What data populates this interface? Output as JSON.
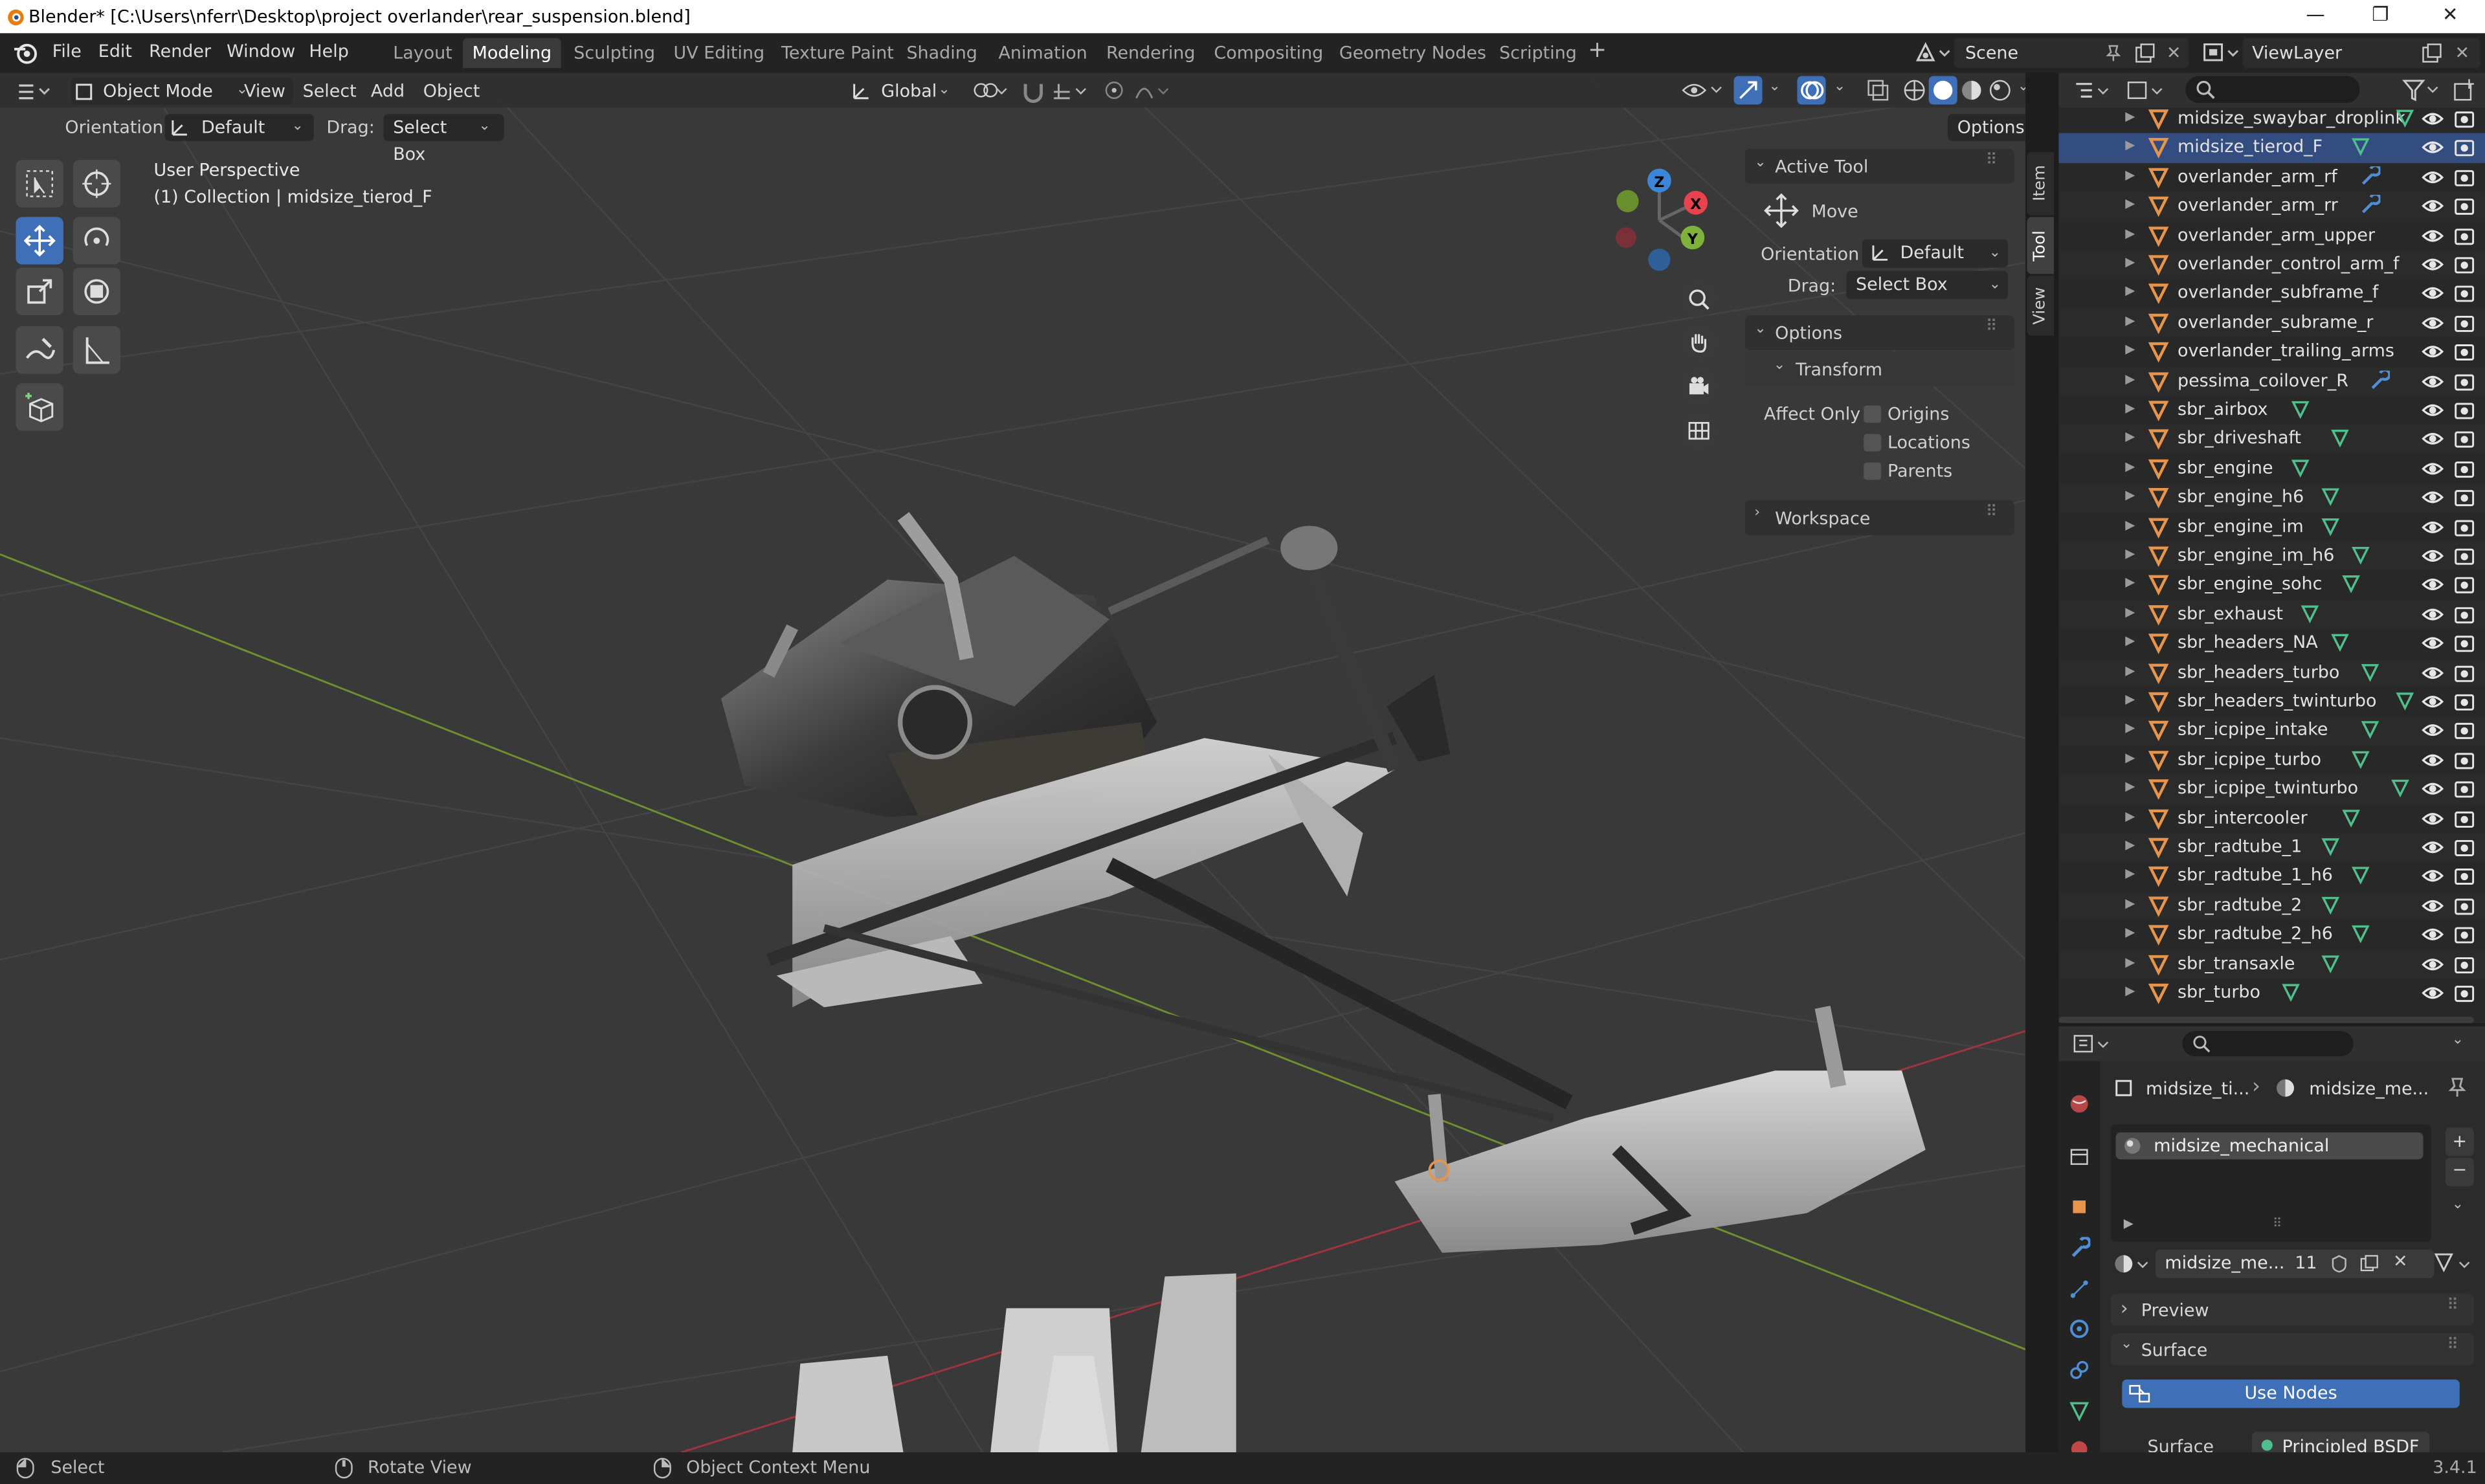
{
  "window": {
    "title": "Blender* [C:\\Users\\nferr\\Desktop\\project overlander\\rear_suspension.blend]",
    "minimize": "—",
    "maximize": "❐",
    "close": "✕"
  },
  "menu": [
    "File",
    "Edit",
    "Render",
    "Window",
    "Help"
  ],
  "workspaces": [
    "Layout",
    "Modeling",
    "Sculpting",
    "UV Editing",
    "Texture Paint",
    "Shading",
    "Animation",
    "Rendering",
    "Compositing",
    "Geometry Nodes",
    "Scripting"
  ],
  "active_workspace": "Modeling",
  "scene": "Scene",
  "view_layer": "ViewLayer",
  "viewport": {
    "mode": "Object Mode",
    "menus": [
      "View",
      "Select",
      "Add",
      "Object"
    ],
    "transform_orientation": "Global",
    "orientation_label": "Orientation:",
    "orientation_value": "Default",
    "drag_label": "Drag:",
    "drag_value": "Select Box",
    "options_label": "Options",
    "perspective": "User Perspective",
    "collection_info": "(1) Collection | midsize_tierod_F",
    "gizmo": {
      "x": "X",
      "y": "Y",
      "z": "Z"
    }
  },
  "npanel": {
    "tabs": [
      "Item",
      "Tool",
      "View"
    ],
    "active_tab": "Tool",
    "active_tool_header": "Active Tool",
    "tool_name": "Move",
    "orientation_label": "Orientation",
    "orientation_value": "Default",
    "drag_label": "Drag:",
    "drag_value": "Select Box",
    "options_header": "Options",
    "transform_header": "Transform",
    "affect_only_label": "Affect Only",
    "affect_only": [
      "Origins",
      "Locations",
      "Parents"
    ],
    "workspace_header": "Workspace"
  },
  "outliner": {
    "search_placeholder": "",
    "items": [
      {
        "name": "midsize_swaybar_droplink",
        "mod": "mesh"
      },
      {
        "name": "midsize_tierod_F",
        "mod": "mesh",
        "selected": true
      },
      {
        "name": "overlander_arm_rf",
        "mod": "wrench"
      },
      {
        "name": "overlander_arm_rr",
        "mod": "wrench"
      },
      {
        "name": "overlander_arm_upper",
        "mod": ""
      },
      {
        "name": "overlander_control_arm_f",
        "mod": ""
      },
      {
        "name": "overlander_subframe_f",
        "mod": ""
      },
      {
        "name": "overlander_subrame_r",
        "mod": ""
      },
      {
        "name": "overlander_trailing_arms",
        "mod": ""
      },
      {
        "name": "pessima_coilover_R",
        "mod": "wrench"
      },
      {
        "name": "sbr_airbox",
        "mod": "mesh"
      },
      {
        "name": "sbr_driveshaft",
        "mod": "mesh"
      },
      {
        "name": "sbr_engine",
        "mod": "mesh"
      },
      {
        "name": "sbr_engine_h6",
        "mod": "mesh"
      },
      {
        "name": "sbr_engine_im",
        "mod": "mesh"
      },
      {
        "name": "sbr_engine_im_h6",
        "mod": "mesh"
      },
      {
        "name": "sbr_engine_sohc",
        "mod": "mesh"
      },
      {
        "name": "sbr_exhaust",
        "mod": "mesh"
      },
      {
        "name": "sbr_headers_NA",
        "mod": "mesh"
      },
      {
        "name": "sbr_headers_turbo",
        "mod": "mesh"
      },
      {
        "name": "sbr_headers_twinturbo",
        "mod": "mesh"
      },
      {
        "name": "sbr_icpipe_intake",
        "mod": "mesh"
      },
      {
        "name": "sbr_icpipe_turbo",
        "mod": "mesh"
      },
      {
        "name": "sbr_icpipe_twinturbo",
        "mod": "mesh"
      },
      {
        "name": "sbr_intercooler",
        "mod": "mesh"
      },
      {
        "name": "sbr_radtube_1",
        "mod": "mesh"
      },
      {
        "name": "sbr_radtube_1_h6",
        "mod": "mesh"
      },
      {
        "name": "sbr_radtube_2",
        "mod": "mesh"
      },
      {
        "name": "sbr_radtube_2_h6",
        "mod": "mesh"
      },
      {
        "name": "sbr_transaxle",
        "mod": "mesh"
      },
      {
        "name": "sbr_turbo",
        "mod": "mesh"
      }
    ]
  },
  "properties": {
    "breadcrumb_object": "midsize_ti...",
    "breadcrumb_material": "midsize_me...",
    "material_slot": "midsize_mechanical",
    "material_name": "midsize_me...",
    "user_count": "11",
    "preview_label": "Preview",
    "surface_label": "Surface",
    "use_nodes_label": "Use Nodes",
    "surface_field_label": "Surface",
    "surface_shader": "Principled BSDF"
  },
  "statusbar": {
    "select": "Select",
    "rotate": "Rotate View",
    "context": "Object Context Menu",
    "version": "3.4.1"
  },
  "colors": {
    "accent": "#3f6fb7",
    "object_icon": "#e8944a",
    "mesh_modifier": "#4fc08d",
    "wrench_modifier": "#4f8fd6",
    "x_axis": "#e8424f",
    "y_axis": "#7fb23a",
    "z_axis": "#3b86d8"
  }
}
